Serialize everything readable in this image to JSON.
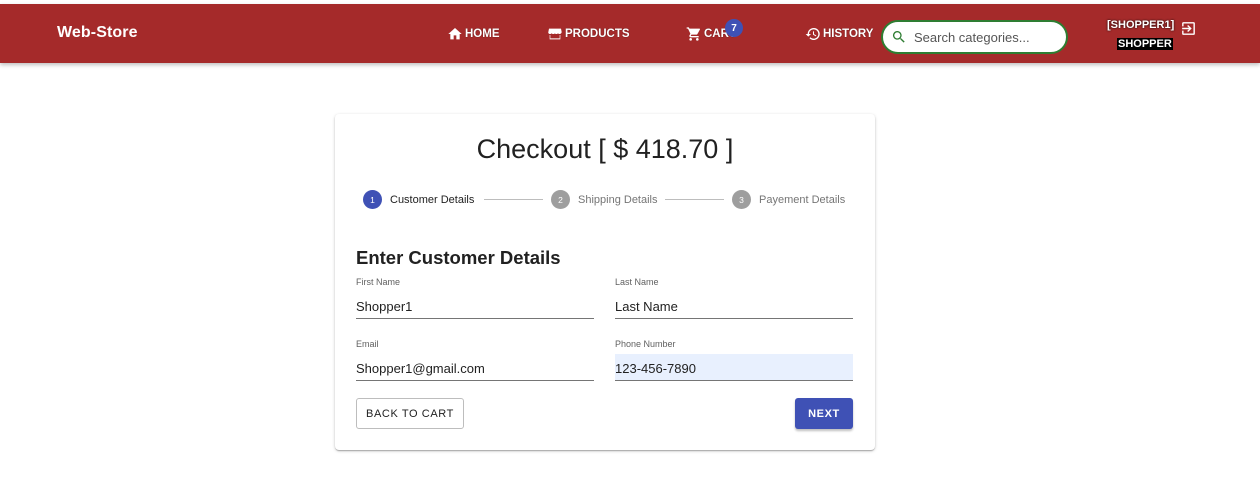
{
  "header": {
    "brand": "Web-Store",
    "nav": {
      "home": "HOME",
      "products": "PRODUCTS",
      "cart": "CART",
      "history": "HISTORY"
    },
    "cart_count": "7",
    "search": {
      "placeholder": "Search categories...",
      "value": ""
    },
    "user": {
      "name": "[SHOPPER1]",
      "role": "SHOPPER"
    },
    "icons": [
      "home-icon",
      "store-icon",
      "cart-icon",
      "history-icon",
      "search-icon",
      "logout-icon"
    ],
    "colors": {
      "bar": "#a52a2a",
      "accent": "#3f51b5",
      "search_border": "#2e7d32"
    }
  },
  "checkout": {
    "title": "Checkout [ $ 418.70 ]",
    "steps": [
      {
        "number": "1",
        "label": "Customer Details",
        "state": "active"
      },
      {
        "number": "2",
        "label": "Shipping Details",
        "state": "inactive"
      },
      {
        "number": "3",
        "label": "Payement Details",
        "state": "inactive"
      }
    ],
    "section_heading": "Enter Customer Details",
    "fields": {
      "first_name": {
        "label": "First Name",
        "value": "Shopper1"
      },
      "last_name": {
        "label": "Last Name",
        "value": "Last Name"
      },
      "email": {
        "label": "Email",
        "value": "Shopper1@gmail.com"
      },
      "phone": {
        "label": "Phone Number",
        "value": "123-456-7890"
      }
    },
    "buttons": {
      "back": "BACK TO CART",
      "next": "NEXT"
    }
  }
}
